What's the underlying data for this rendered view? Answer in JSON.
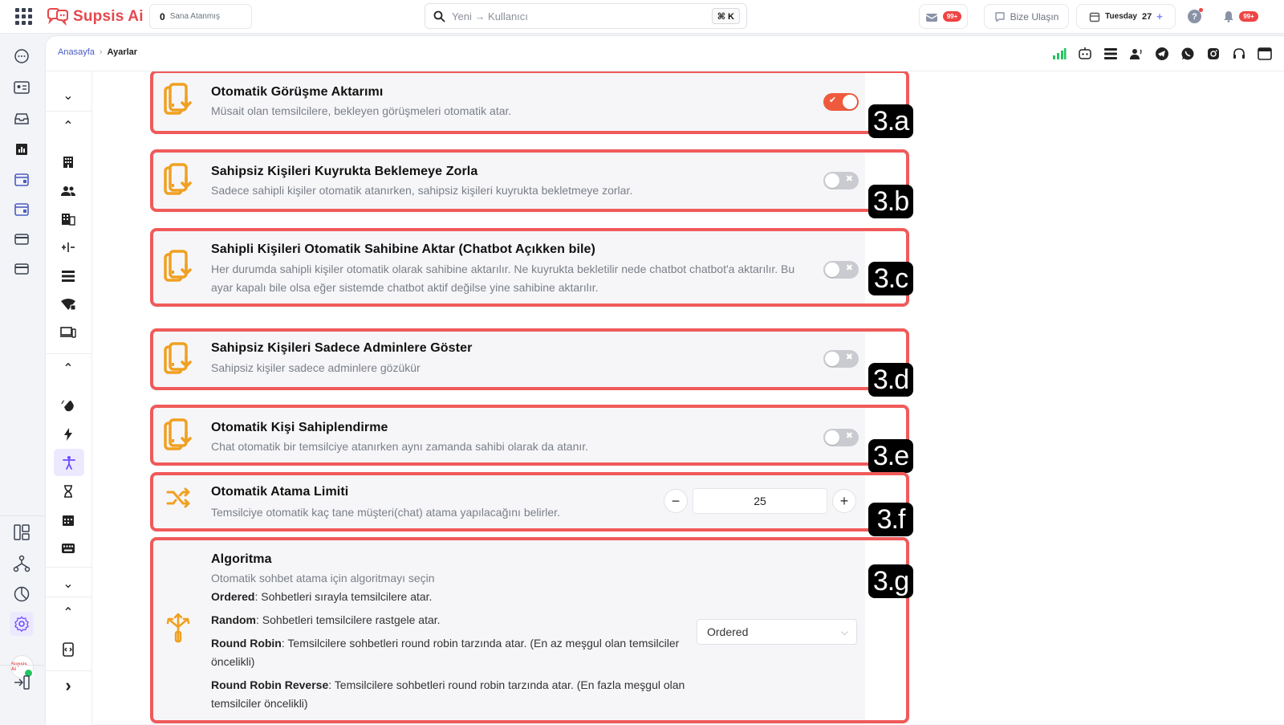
{
  "topbar": {
    "logo_text": "Supsis Ai",
    "assigned_count": "0",
    "assigned_label": "Sana Atanmış",
    "search_placeholder": "Yeni → Kullanıcı",
    "search_shortcut": "⌘ K",
    "mail_badge": "99+",
    "contact_label": "Bize Ulaşın",
    "date_day": "Tuesday",
    "date_num": "27",
    "notif_badge": "99+"
  },
  "breadcrumb": {
    "home": "Anasayfa",
    "separator": "›",
    "current": "Ayarlar"
  },
  "colors": {
    "accent": "#ef5a3c",
    "frame": "#f05a5a",
    "icon_orange": "#f0a020",
    "brand_red": "#e5484d",
    "active_purple": "#6d4aff"
  },
  "settings": [
    {
      "tag": "3.a",
      "title": "Otomatik Görüşme Aktarımı",
      "desc": "Müsait olan temsilcilere, bekleyen görüşmeleri otomatik atar.",
      "enabled": true,
      "on_mark": "✔",
      "off_mark": ""
    },
    {
      "tag": "3.b",
      "title": "Sahipsiz Kişileri Kuyrukta Beklemeye Zorla",
      "desc": "Sadece sahipli kişiler otomatik atanırken, sahipsiz kişileri kuyrukta bekletmeye zorlar.",
      "enabled": false,
      "off_mark": "✖"
    },
    {
      "tag": "3.c",
      "title": "Sahipli Kişileri Otomatik Sahibine Aktar (Chatbot Açıkken bile)",
      "desc": "Her durumda sahipli kişiler otomatik olarak sahibine aktarılır. Ne kuyrukta bekletilir nede chatbot chatbot'a aktarılır. Bu ayar kapalı bile olsa eğer sistemde chatbot aktif değilse yine sahibine aktarılır.",
      "enabled": false,
      "off_mark": "✖"
    },
    {
      "tag": "3.d",
      "title": "Sahipsiz Kişileri Sadece Adminlere Göster",
      "desc": "Sahipsiz kişiler sadece adminlere gözükür",
      "enabled": false,
      "off_mark": "✖"
    },
    {
      "tag": "3.e",
      "title": "Otomatik Kişi Sahiplendirme",
      "desc": "Chat otomatik bir temsilciye atanırken aynı zamanda sahibi olarak da atanır.",
      "enabled": false,
      "off_mark": "✖"
    }
  ],
  "limit": {
    "tag": "3.f",
    "title": "Otomatik Atama Limiti",
    "desc": "Temsilciye otomatik kaç tane müşteri(chat) atama yapılacağını belirler.",
    "value": "25",
    "minus": "−",
    "plus": "+"
  },
  "algorithm": {
    "tag": "3.g",
    "title": "Algoritma",
    "desc": "Otomatik sohbet atama için algoritmayı seçin",
    "options": [
      {
        "name": "Ordered",
        "text": ": Sohbetleri sırayla temsilcilere atar."
      },
      {
        "name": "Random",
        "text": ": Sohbetleri temsilcilere rastgele atar."
      },
      {
        "name": "Round Robin",
        "text": ": Temsilcilere sohbetleri round robin tarzında atar. (En az meşgul olan temsilciler öncelikli)"
      },
      {
        "name": "Round Robin Reverse",
        "text": ": Temsilcilere sohbetleri round robin tarzında atar. (En fazla meşgul olan temsilciler öncelikli)"
      }
    ],
    "selected": "Ordered",
    "chevron": "⌵"
  },
  "rail_icons": [
    "chat-icon",
    "contact-card-icon",
    "inbox-icon",
    "report-icon",
    "window-icon",
    "window-alt-icon",
    "card-icon",
    "card-alt-icon",
    "dashboard-icon",
    "flow-icon",
    "pie-chart-icon",
    "settings-icon",
    "avatar",
    "sidebar-expand-icon"
  ],
  "avatar_text": "Supsis Ai",
  "subnav": {
    "chevron_up": "⌃",
    "chevron_down": "⌄",
    "chevron_right": "›"
  }
}
